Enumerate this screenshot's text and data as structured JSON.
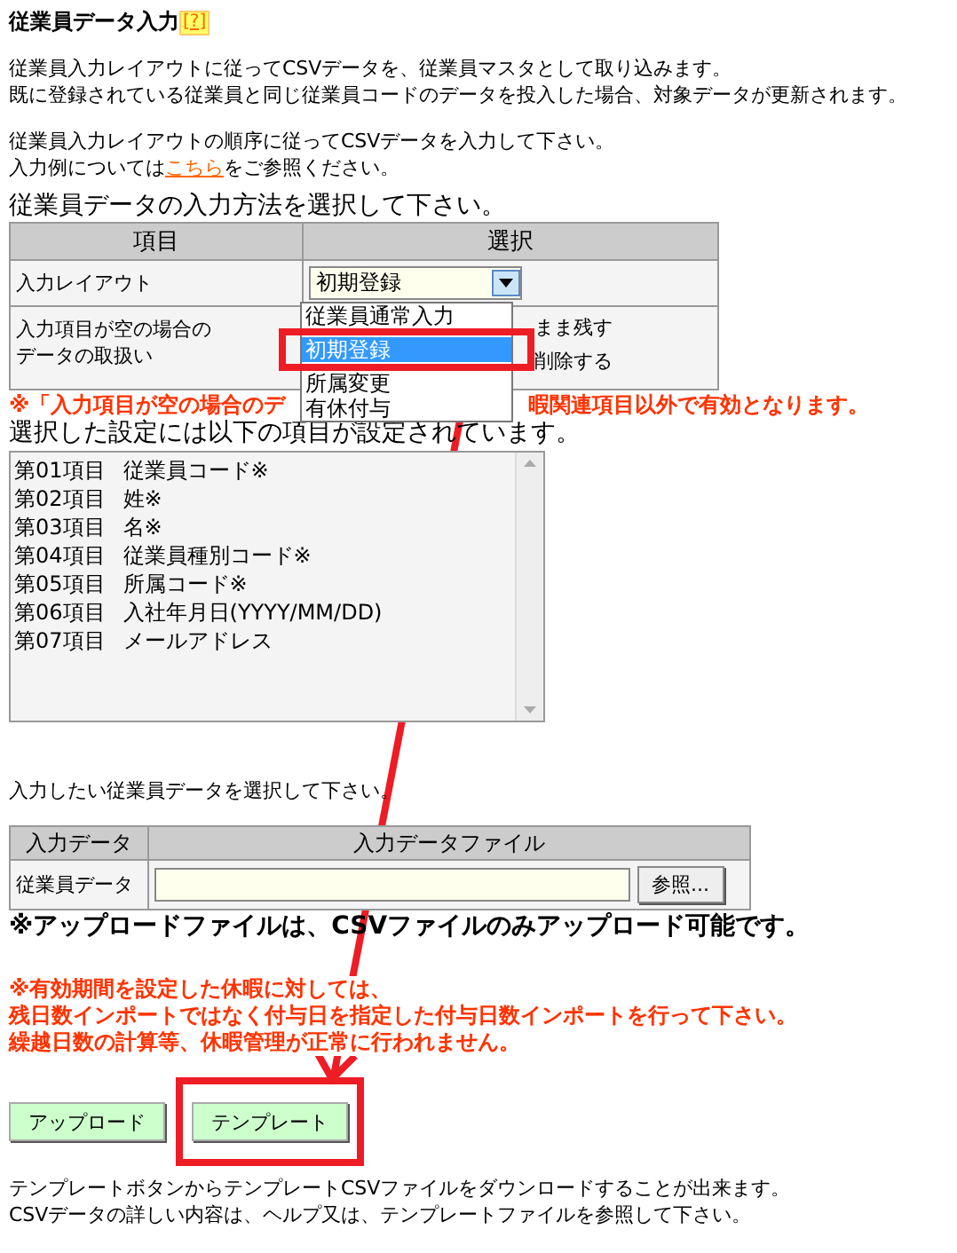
{
  "title": {
    "text": "従業員データ入力",
    "help": "[?]"
  },
  "intro": [
    "従業員入力レイアウトに従ってCSVデータを、従業員マスタとして取り込みます。",
    "既に登録されている従業員と同じ従業員コードのデータを投入した場合、対象データが更新されます。"
  ],
  "instruction": {
    "line1": "従業員入力レイアウトの順序に従ってCSVデータを入力して下さい。",
    "before_link": "入力例については",
    "link": "こちら",
    "after_link": "をご参照ください。"
  },
  "method_heading": "従業員データの入力方法を選択して下さい。",
  "method_table": {
    "columns": [
      "項目",
      "選択"
    ],
    "layout_label": "入力レイアウト",
    "layout_value": "初期登録",
    "layout_options": [
      {
        "label": "従業員通常入力",
        "selected": false
      },
      {
        "label": "初期登録",
        "selected": true
      },
      {
        "label": "所属変更",
        "selected": false
      },
      {
        "label": "有休付与",
        "selected": false
      }
    ],
    "empty_label": [
      "入力項目が空の場合の",
      "データの取扱い"
    ],
    "empty_options": [
      "まま残す",
      "削除する"
    ]
  },
  "warning": [
    "※「入力項目が空の場合のデ",
    "暇関連項目以外で有効となります。"
  ],
  "items_heading": "選択した設定には以下の項目が設定されています。",
  "items": [
    {
      "no": "第01項目",
      "name": "従業員コード※"
    },
    {
      "no": "第02項目",
      "name": "姓※"
    },
    {
      "no": "第03項目",
      "name": "名※"
    },
    {
      "no": "第04項目",
      "name": "従業員種別コード※"
    },
    {
      "no": "第05項目",
      "name": "所属コード※"
    },
    {
      "no": "第06項目",
      "name": "入社年月日(YYYY/MM/DD)"
    },
    {
      "no": "第07項目",
      "name": "メールアドレス"
    }
  ],
  "file_prompt": "入力したい従業員データを選択して下さい。",
  "file_table": {
    "columns": [
      "入力データ",
      "入力データファイル"
    ],
    "row_label": "従業員データ",
    "browse": "参照..."
  },
  "upload_note": "※アップロードファイルは、CSVファイルのみアップロード可能です。",
  "caution": [
    "※有効期間を設定した休暇に対しては、",
    "残日数インポートではなく付与日を指定した付与日数インポートを行って下さい。",
    "繰越日数の計算等、休暇管理が正常に行われません。"
  ],
  "buttons": [
    "アップロード",
    "テンプレート"
  ],
  "footer": [
    "テンプレートボタンからテンプレートCSVファイルをダウンロードすることが出来ます。",
    "CSVデータの詳しい内容は、ヘルプ又は、テンプレートファイルを参照して下さい。"
  ]
}
